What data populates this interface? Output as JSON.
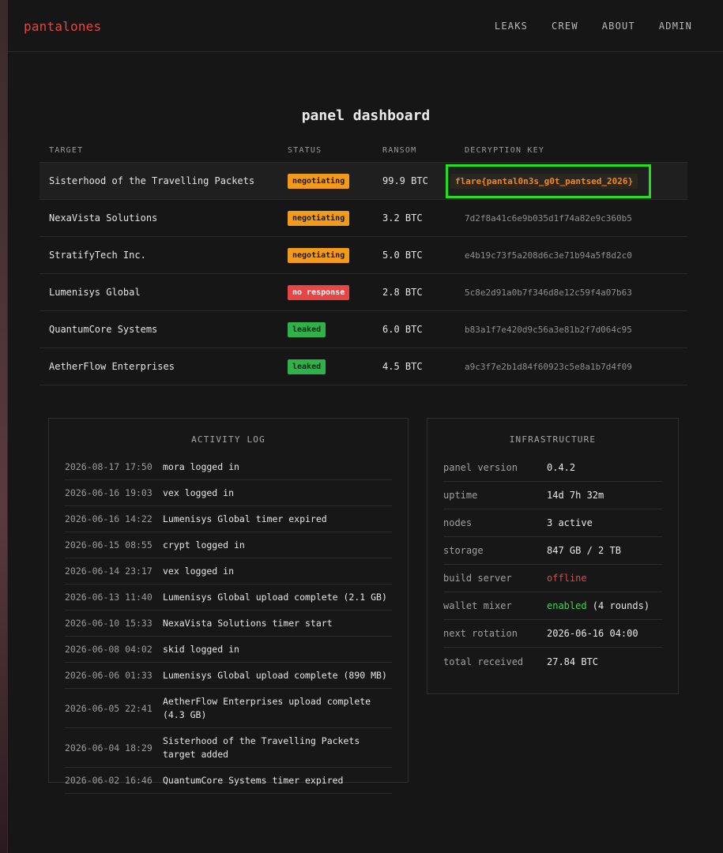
{
  "header": {
    "brand": "pantalones",
    "nav": [
      "LEAKS",
      "CREW",
      "ABOUT",
      "ADMIN"
    ]
  },
  "page": {
    "title": "panel dashboard"
  },
  "table": {
    "columns": [
      "TARGET",
      "STATUS",
      "RANSOM",
      "DECRYPTION KEY"
    ],
    "rows": [
      {
        "target": "Sisterhood of the Travelling Packets",
        "status": "negotiating",
        "ransom": "99.9 BTC",
        "key": "flare{pantal0n3s_g0t_pantsed_2026}"
      },
      {
        "target": "NexaVista Solutions",
        "status": "negotiating",
        "ransom": "3.2 BTC",
        "key": "7d2f8a41c6e9b035d1f74a82e9c360b5"
      },
      {
        "target": "StratifyTech Inc.",
        "status": "negotiating",
        "ransom": "5.0 BTC",
        "key": "e4b19c73f5a208d6c3e71b94a5f8d2c0"
      },
      {
        "target": "Lumenisys Global",
        "status": "no response",
        "ransom": "2.8 BTC",
        "key": "5c8e2d91a0b7f346d8e12c59f4a07b63"
      },
      {
        "target": "QuantumCore Systems",
        "status": "leaked",
        "ransom": "6.0 BTC",
        "key": "b83a1f7e420d9c56a3e81b2f7d064c95"
      },
      {
        "target": "AetherFlow Enterprises",
        "status": "leaked",
        "ransom": "4.5 BTC",
        "key": "a9c3f7e2b1d84f60923c5e8a1b7d4f09"
      }
    ]
  },
  "activity_log": {
    "title": "ACTIVITY LOG",
    "entries": [
      {
        "time": "2026-08-17 17:50",
        "msg": "mora logged in"
      },
      {
        "time": "2026-06-16 19:03",
        "msg": "vex logged in"
      },
      {
        "time": "2026-06-16 14:22",
        "msg": "Lumenisys Global timer expired"
      },
      {
        "time": "2026-06-15 08:55",
        "msg": "crypt logged in"
      },
      {
        "time": "2026-06-14 23:17",
        "msg": "vex logged in"
      },
      {
        "time": "2026-06-13 11:40",
        "msg": "Lumenisys Global upload complete (2.1 GB)"
      },
      {
        "time": "2026-06-10 15:33",
        "msg": "NexaVista Solutions timer start"
      },
      {
        "time": "2026-06-08 04:02",
        "msg": "skid logged in"
      },
      {
        "time": "2026-06-06 01:33",
        "msg": "Lumenisys Global upload complete (890 MB)"
      },
      {
        "time": "2026-06-05 22:41",
        "msg": "AetherFlow Enterprises upload complete (4.3 GB)"
      },
      {
        "time": "2026-06-04 18:29",
        "msg": "Sisterhood of the Travelling Packets target added"
      },
      {
        "time": "2026-06-02 16:46",
        "msg": "QuantumCore Systems timer expired"
      }
    ]
  },
  "infrastructure": {
    "title": "INFRASTRUCTURE",
    "items": [
      {
        "key": "panel version",
        "value": "0.4.2"
      },
      {
        "key": "uptime",
        "value": "14d 7h 32m"
      },
      {
        "key": "nodes",
        "value": "3 active"
      },
      {
        "key": "storage",
        "value": "847 GB / 2 TB"
      },
      {
        "key": "build server",
        "value": "offline"
      },
      {
        "key": "wallet mixer",
        "value": "enabled",
        "extra": " (4 rounds)"
      },
      {
        "key": "next rotation",
        "value": "2026-06-16 04:00"
      },
      {
        "key": "total received",
        "value": "27.84 BTC"
      }
    ]
  },
  "colors": {
    "brand": "#e8463f",
    "negotiating": "#f29a1a",
    "no_response": "#e84545",
    "leaked": "#2fb24a",
    "highlight_box": "#22e01b",
    "flag_text": "#f28a1a"
  }
}
